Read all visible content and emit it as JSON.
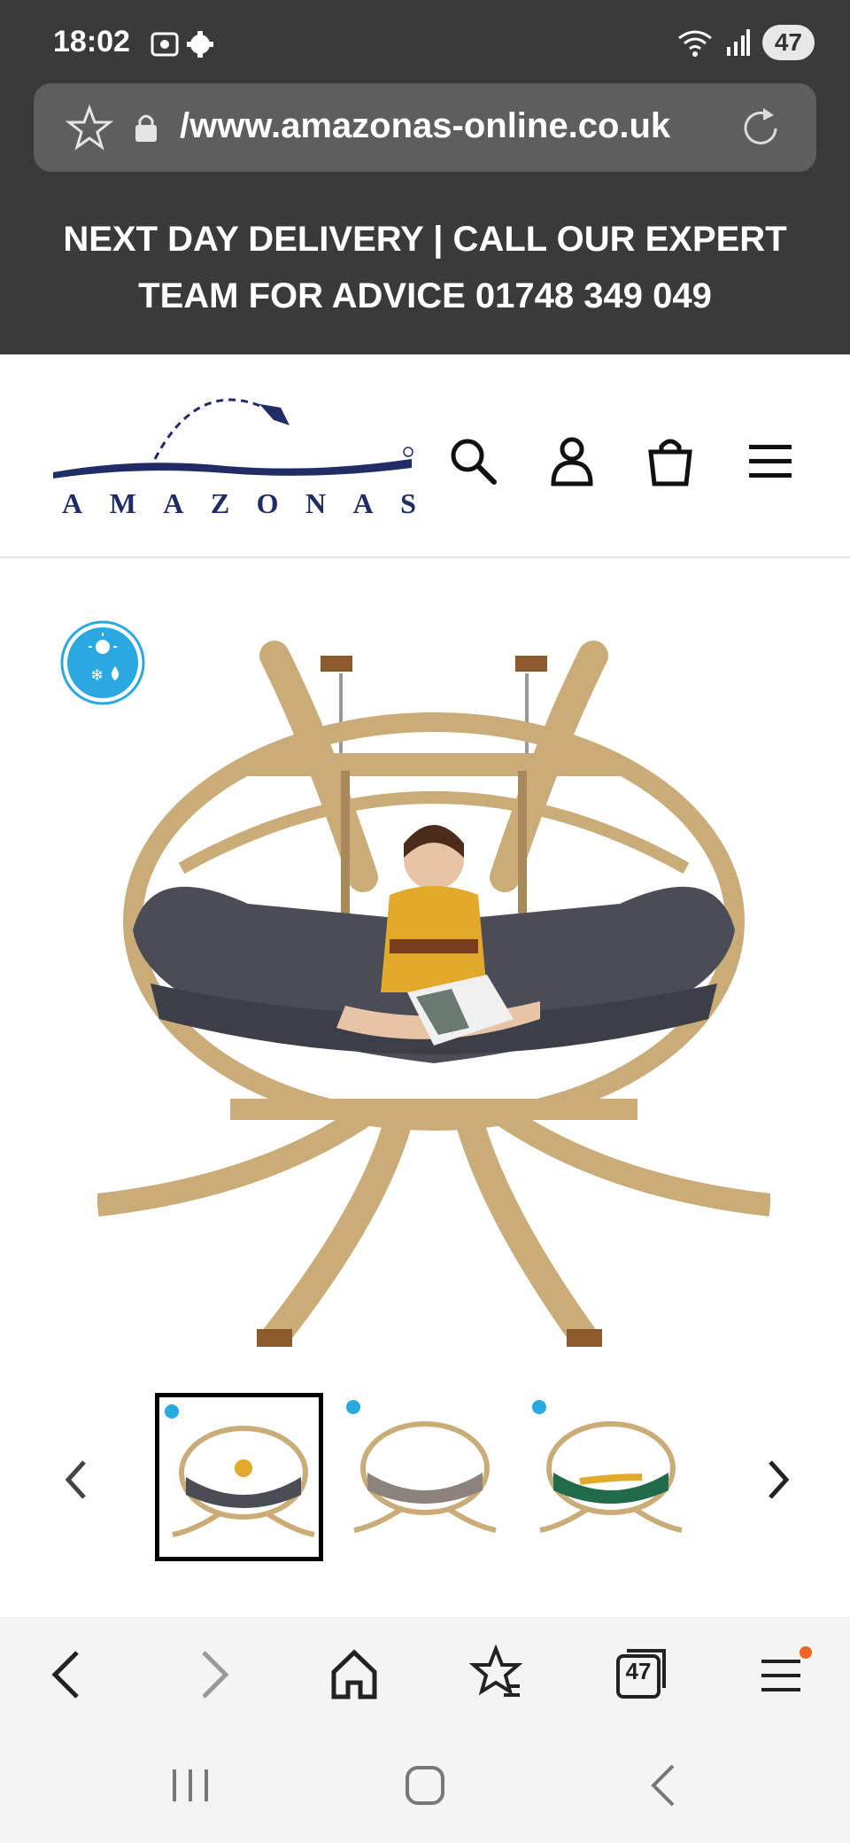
{
  "status_bar": {
    "time": "18:02",
    "battery": "47",
    "icons": [
      "screenshot-icon",
      "settings-gear-icon",
      "wifi-icon",
      "signal-icon"
    ]
  },
  "address_bar": {
    "url": "/www.amazonas-online.co.uk",
    "icons": [
      "star-icon",
      "lock-icon",
      "reload-icon"
    ]
  },
  "promo": {
    "line1": "NEXT DAY DELIVERY | CALL OUR EXPERT",
    "line2": "TEAM FOR ADVICE 01748 349 049"
  },
  "header": {
    "logo_text": [
      "A",
      "M",
      "A",
      "Z",
      "O",
      "N",
      "A",
      "S"
    ],
    "icons": [
      "search-icon",
      "account-icon",
      "cart-icon",
      "menu-icon"
    ]
  },
  "product": {
    "badge_icon": "weather-sun-snow-rain-icon",
    "thumbnail_cushions": [
      "anthracite",
      "taupe",
      "green"
    ],
    "selected_thumb_index": 0
  },
  "browser_nav": {
    "tab_count": "47",
    "icons": [
      "back-icon",
      "forward-icon",
      "home-icon",
      "bookmarks-icon",
      "tabs-icon",
      "menu-icon"
    ]
  },
  "colors": {
    "header_dark": "#3a3a3a",
    "brand_navy": "#1f2c66",
    "wood": "#c9ac78",
    "cushion_grey": "#4a4d56",
    "badge_blue": "#2aa9e0",
    "notification_dot": "#f26522"
  }
}
